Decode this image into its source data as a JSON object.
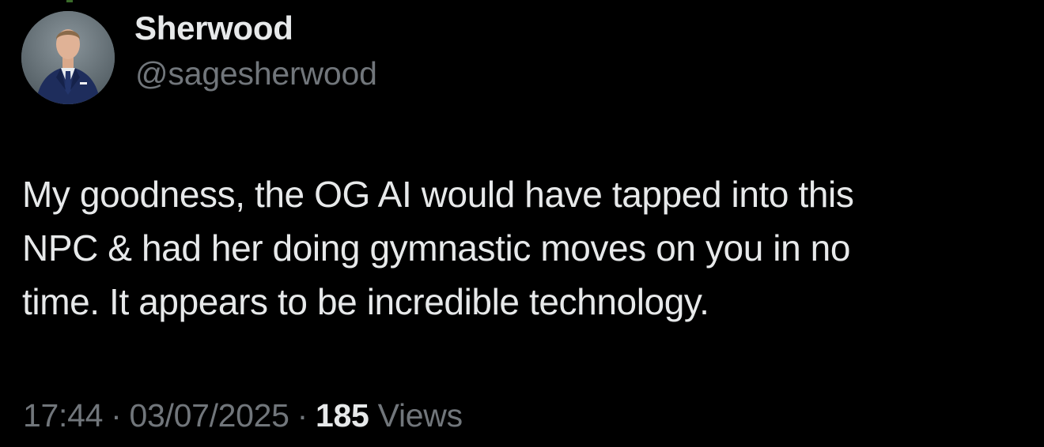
{
  "author": {
    "display_name": "Sherwood",
    "handle": "@sagesherwood",
    "avatar_icon": "profile-photo-man-in-suit"
  },
  "post": {
    "lines": [
      "My goodness, the OG AI would have tapped into this",
      "NPC & had her doing gymnastic moves on you in no",
      "time. It appears to be incredible technology."
    ]
  },
  "meta": {
    "time": "17:44",
    "separator": "·",
    "date": "03/07/2025",
    "views_count": "185",
    "views_label": "Views"
  },
  "colors": {
    "background": "#000000",
    "primary_text": "#e7e9ea",
    "secondary_text": "#71767b"
  }
}
